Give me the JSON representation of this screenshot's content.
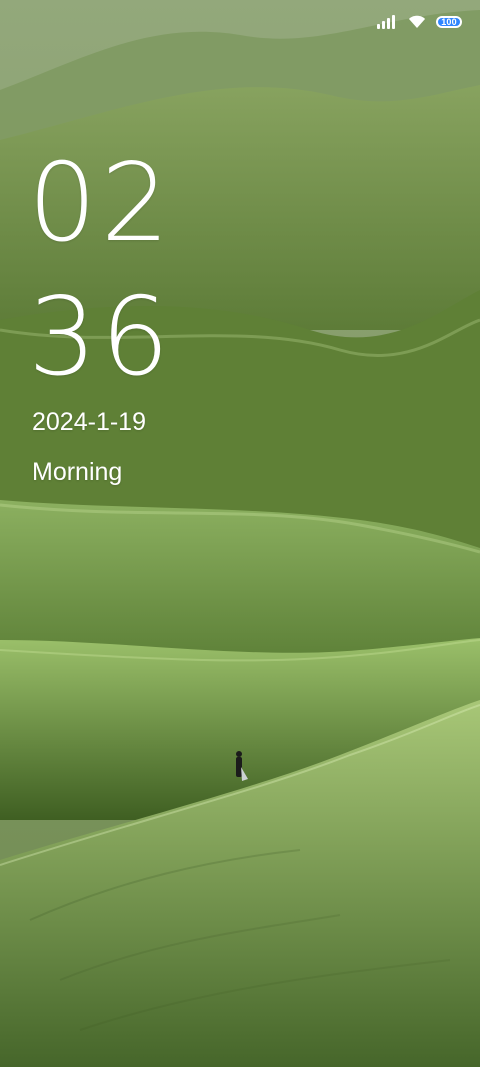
{
  "status_bar": {
    "battery_level": "100",
    "icons": [
      "signal-icon",
      "wifi-icon",
      "battery-icon"
    ]
  },
  "lock_screen": {
    "time_hours": "02",
    "time_minutes": "36",
    "date": "2024-1-19",
    "greeting": "Morning"
  },
  "colors": {
    "battery_fill": "#2f86ff",
    "text": "#ffffff"
  }
}
